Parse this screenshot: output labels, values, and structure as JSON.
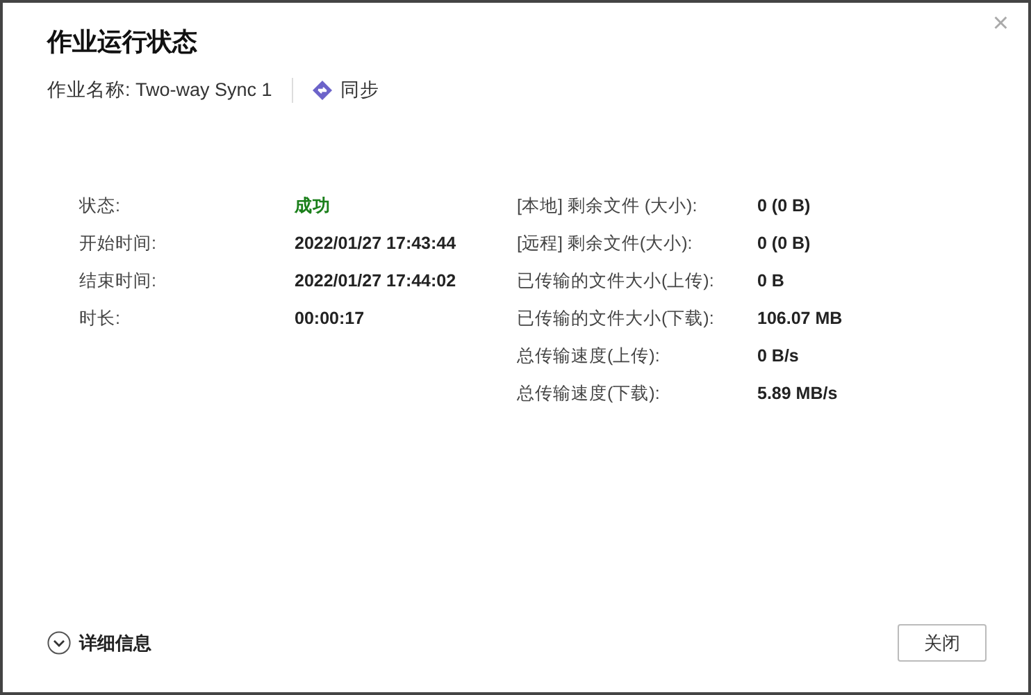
{
  "dialog": {
    "title": "作业运行状态",
    "close_icon": "×"
  },
  "job": {
    "label": "作业名称: Two-way Sync 1",
    "mode": "同步"
  },
  "left_rows": [
    {
      "label": "状态:",
      "value": "成功",
      "kind": "success"
    },
    {
      "label": "开始时间:",
      "value": "2022/01/27 17:43:44",
      "kind": "plain"
    },
    {
      "label": "结束时间:",
      "value": "2022/01/27 17:44:02",
      "kind": "plain"
    },
    {
      "label": "时长:",
      "value": "00:00:17",
      "kind": "plain"
    }
  ],
  "right_rows": [
    {
      "label": "[本地] 剩余文件 (大小):",
      "value": "0 (0 B)"
    },
    {
      "label": "[远程] 剩余文件(大小):",
      "value": "0 (0 B)"
    },
    {
      "label": "已传输的文件大小(上传):",
      "value": "0 B"
    },
    {
      "label": "已传输的文件大小(下载):",
      "value": "106.07 MB"
    },
    {
      "label": "总传输速度(上传):",
      "value": "0 B/s"
    },
    {
      "label": "总传输速度(下载):",
      "value": "5.89 MB/s"
    }
  ],
  "details": {
    "label": "详细信息",
    "expanded": false
  },
  "buttons": [
    "关闭"
  ]
}
